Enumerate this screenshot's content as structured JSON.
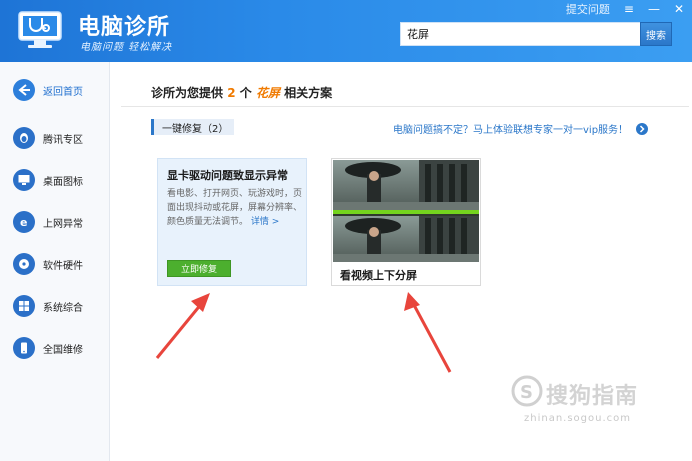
{
  "header": {
    "title": "电脑诊所",
    "subtitle": "电脑问题 轻松解决",
    "top_links": {
      "submit": "提交问题",
      "menu": "≡",
      "minimize": "—",
      "close": "✕"
    },
    "search": {
      "value": "花屏",
      "button": "搜索"
    }
  },
  "sidebar": {
    "items": [
      {
        "label": "返回首页"
      },
      {
        "label": "腾讯专区"
      },
      {
        "label": "桌面图标"
      },
      {
        "label": "上网异常"
      },
      {
        "label": "软件硬件"
      },
      {
        "label": "系统综合"
      },
      {
        "label": "全国维修"
      }
    ]
  },
  "main": {
    "result": {
      "prefix": "诊所为您提供",
      "count": "2",
      "unit": "个",
      "keyword": "花屏",
      "suffix": "相关方案"
    },
    "tag_label": "一键修复（2）",
    "promo_text": "电脑问题搞不定？马上体验联想专家一对一vip服务！",
    "card1": {
      "title": "显卡驱动问题致显示异常",
      "desc": "看电影、打开网页、玩游戏时，页面出现抖动或花屏，屏幕分辨率、颜色质量无法调节。",
      "more": "详情 >",
      "button": "立即修复"
    },
    "card2": {
      "title": "看视频上下分屏"
    }
  },
  "watermark": {
    "text": "搜狗指南",
    "url": "zhinan.sogou.com"
  },
  "colors": {
    "header_blue": "#2a8ae8",
    "accent_orange": "#f07a00",
    "link_blue": "#2b77c9",
    "fix_green": "#4caf2e",
    "arrow_red": "#e8453c"
  }
}
